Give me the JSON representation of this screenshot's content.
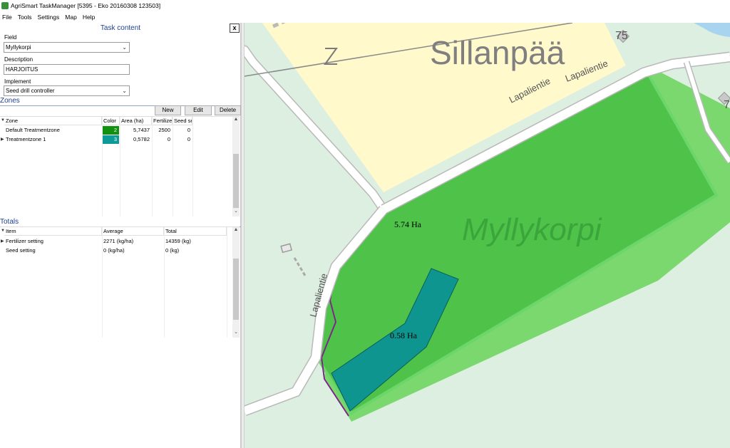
{
  "window": {
    "title": "AgriSmart TaskManager [5395 - Eko 20160308 123503]"
  },
  "menu": {
    "file": "File",
    "tools": "Tools",
    "settings": "Settings",
    "map": "Map",
    "help": "Help"
  },
  "panel": {
    "title": "Task content",
    "close_label": "x",
    "field_label": "Field",
    "field_value": "Myllykorpi",
    "description_label": "Description",
    "description_value": "HARJOITUS",
    "implement_label": "Implement",
    "implement_value": "Seed drill controller"
  },
  "zones": {
    "title": "Zones",
    "buttons": {
      "new": "New",
      "edit": "Edit",
      "delete": "Delete"
    },
    "columns": {
      "zone": "Zone",
      "color": "Color",
      "area": "Area (ha)",
      "fertilizer": "Fertilize",
      "seed": "Seed se"
    },
    "rows": [
      {
        "zone": "Default Treatmentzone",
        "color": "2",
        "color_hex": "#12900f",
        "area": "5,7437",
        "fertilizer": "2500",
        "seed": "0"
      },
      {
        "zone": "Treatmentzone 1",
        "color": "3",
        "color_hex": "#0f9a96",
        "area": "0,5782",
        "fertilizer": "0",
        "seed": "0"
      }
    ]
  },
  "totals": {
    "title": "Totals",
    "columns": {
      "item": "Item",
      "average": "Average",
      "total": "Total"
    },
    "rows": [
      {
        "item": "Fertilizer setting",
        "average": "2271 (kg/ha)",
        "total": "14359 (kg)"
      },
      {
        "item": "Seed setting",
        "average": "0 (kg/ha)",
        "total": "0 (kg)"
      }
    ]
  },
  "map": {
    "place_label": "Sillanpää",
    "field_label": "Myllykorpi",
    "road_label_1": "Lapalientie",
    "road_label_2": "Lapalientie",
    "road_label_3": "Lapalientie",
    "house_number_1": "75",
    "house_number_2": "7",
    "zone_area_1": "5.74 Ha",
    "zone_area_2": "0.58 Ha",
    "colors": {
      "meadow": "#fff9cc",
      "field": "#4fc24a",
      "field_border": "#6bd66a",
      "zone": "#0f9590",
      "road": "#ffffff",
      "boundary": "#7a2a86",
      "background": "#dcefe1"
    }
  }
}
